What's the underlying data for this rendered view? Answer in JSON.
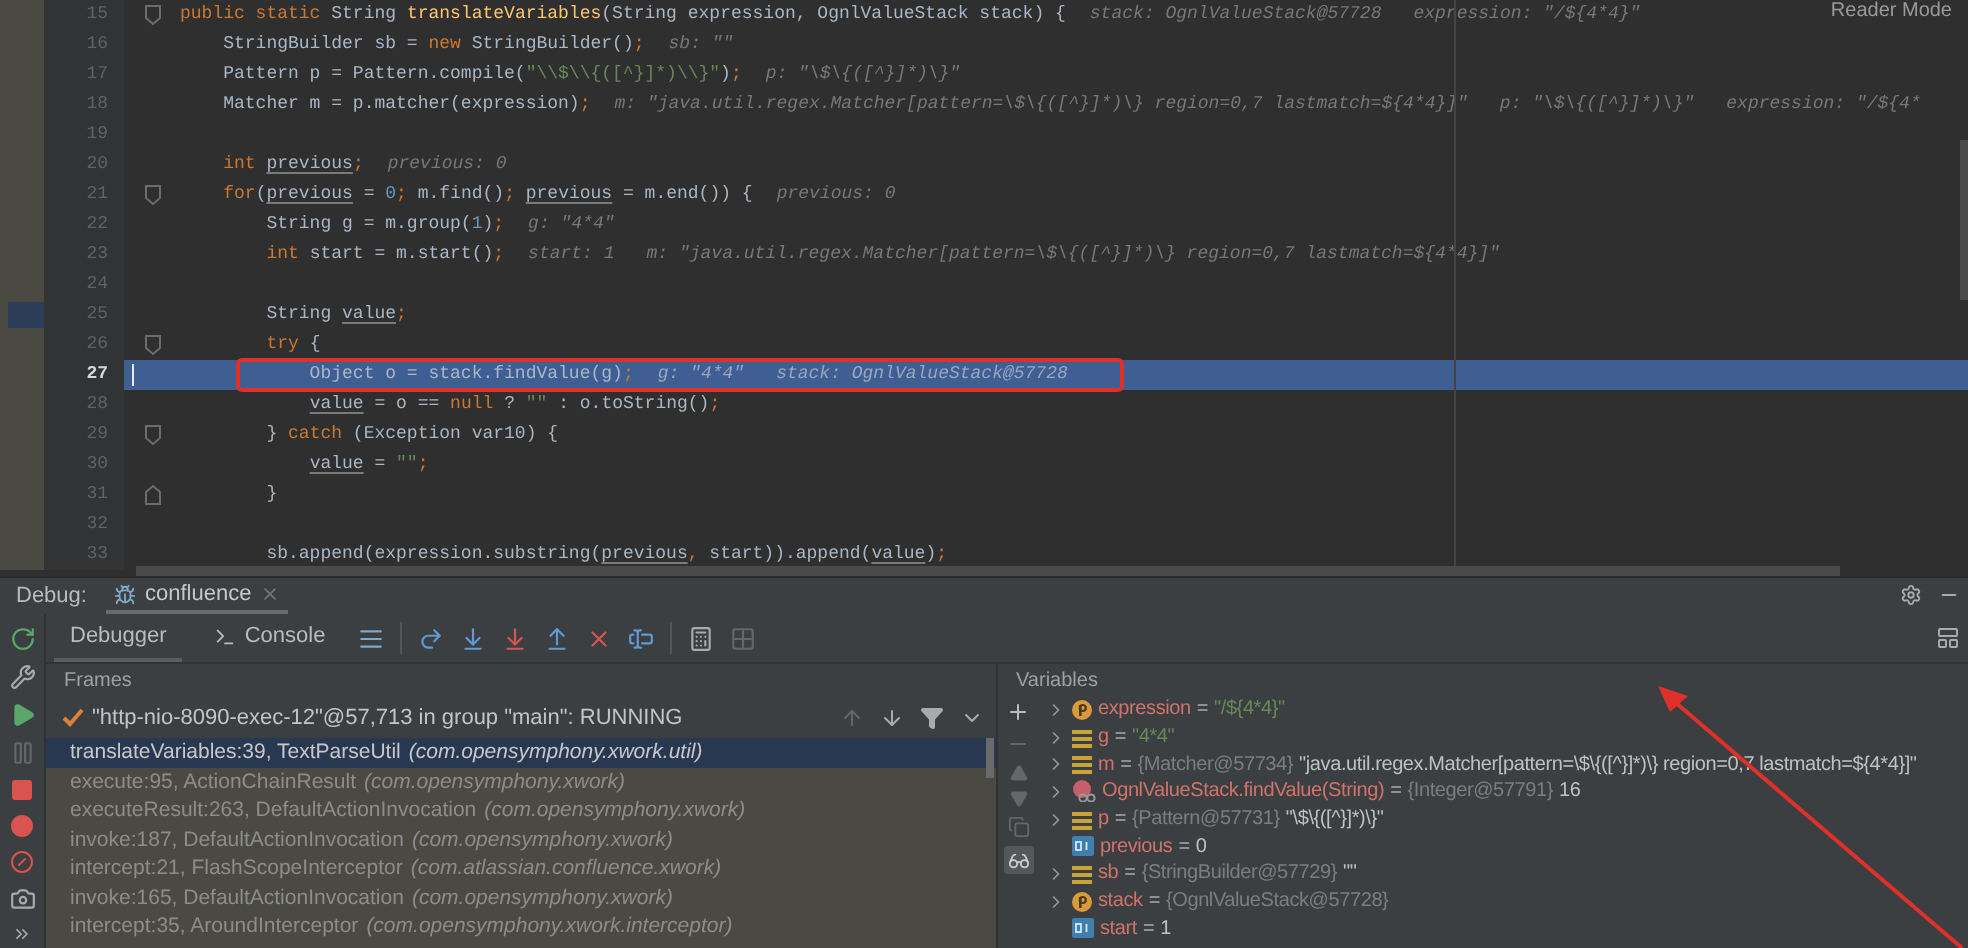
{
  "editor": {
    "reader_mode": "Reader Mode",
    "lines": [
      {
        "number": "15",
        "current": false,
        "bookmarked": false,
        "fold_start": true,
        "fold_end": false,
        "tokens": [
          {
            "kind": "kw",
            "text": "public static "
          },
          {
            "kind": "txt",
            "text": "String "
          },
          {
            "kind": "method",
            "text": "translateVariables"
          },
          {
            "kind": "txt",
            "text": "(String expression, OgnlValueStack stack) {"
          },
          {
            "kind": "hint",
            "text": "stack: OgnlValueStack@57728"
          },
          {
            "kind": "hint",
            "text": "expression: \"/${4*4}\""
          }
        ]
      },
      {
        "number": "16",
        "current": false,
        "bookmarked": false,
        "fold_start": false,
        "fold_end": false,
        "tokens": [
          {
            "kind": "txt",
            "text": "    StringBuilder sb = "
          },
          {
            "kind": "kw",
            "text": "new "
          },
          {
            "kind": "txt",
            "text": "StringBuilder()"
          },
          {
            "kind": "kw",
            "text": ";"
          },
          {
            "kind": "hint",
            "text": "sb: \"\""
          }
        ]
      },
      {
        "number": "17",
        "current": false,
        "bookmarked": false,
        "fold_start": false,
        "fold_end": false,
        "tokens": [
          {
            "kind": "txt",
            "text": "    Pattern p = Pattern.compile("
          },
          {
            "kind": "str",
            "text": "\"\\\\$\\\\{([^}]*)\\\\}\""
          },
          {
            "kind": "txt",
            "text": ")"
          },
          {
            "kind": "kw",
            "text": ";"
          },
          {
            "kind": "hint",
            "text": "p: \"\\$\\{([^}]*)\\}\""
          }
        ]
      },
      {
        "number": "18",
        "current": false,
        "bookmarked": false,
        "fold_start": false,
        "fold_end": false,
        "tokens": [
          {
            "kind": "txt",
            "text": "    Matcher m = p.matcher(expression)"
          },
          {
            "kind": "kw",
            "text": ";"
          },
          {
            "kind": "hint",
            "text": "m: \"java.util.regex.Matcher[pattern=\\$\\{([^}]*)\\} region=0,7 lastmatch=${4*4}]\""
          },
          {
            "kind": "hint",
            "text": "p: \"\\$\\{([^}]*)\\}\""
          },
          {
            "kind": "hint",
            "text": "expression: \"/${4*"
          }
        ]
      },
      {
        "number": "19",
        "current": false,
        "bookmarked": false,
        "fold_start": false,
        "fold_end": false
      },
      {
        "number": "20",
        "current": false,
        "bookmarked": false,
        "fold_start": false,
        "fold_end": false,
        "tokens": [
          {
            "kind": "kw",
            "text": "    int "
          },
          {
            "kind": "var",
            "text": "previous"
          },
          {
            "kind": "kw",
            "text": ";"
          },
          {
            "kind": "hint",
            "text": "previous: 0"
          }
        ]
      },
      {
        "number": "21",
        "current": false,
        "bookmarked": false,
        "fold_start": true,
        "fold_end": false,
        "tokens": [
          {
            "kind": "kw",
            "text": "    for"
          },
          {
            "kind": "txt",
            "text": "("
          },
          {
            "kind": "var",
            "text": "previous"
          },
          {
            "kind": "txt",
            "text": " = "
          },
          {
            "kind": "num",
            "text": "0"
          },
          {
            "kind": "kw",
            "text": ";"
          },
          {
            "kind": "txt",
            "text": " m.find()"
          },
          {
            "kind": "kw",
            "text": ";"
          },
          {
            "kind": "var",
            "text": " previous"
          },
          {
            "kind": "txt",
            "text": " = m.end()) {"
          },
          {
            "kind": "hint",
            "text": "previous: 0"
          }
        ]
      },
      {
        "number": "22",
        "current": false,
        "bookmarked": false,
        "fold_start": false,
        "fold_end": false,
        "tokens": [
          {
            "kind": "txt",
            "text": "        String g = m.group("
          },
          {
            "kind": "num",
            "text": "1"
          },
          {
            "kind": "txt",
            "text": ")"
          },
          {
            "kind": "kw",
            "text": ";"
          },
          {
            "kind": "hint",
            "text": "g: \"4*4\""
          }
        ]
      },
      {
        "number": "23",
        "current": false,
        "bookmarked": false,
        "fold_start": false,
        "fold_end": false,
        "tokens": [
          {
            "kind": "kw",
            "text": "        int "
          },
          {
            "kind": "txt",
            "text": "start = m.start()"
          },
          {
            "kind": "kw",
            "text": ";"
          },
          {
            "kind": "hint",
            "text": "start: 1"
          },
          {
            "kind": "hint",
            "text": "m: \"java.util.regex.Matcher[pattern=\\$\\{([^}]*)\\} region=0,7 lastmatch=${4*4}]\""
          }
        ]
      },
      {
        "number": "24",
        "current": false,
        "bookmarked": false,
        "fold_start": false,
        "fold_end": false
      },
      {
        "number": "25",
        "current": false,
        "bookmarked": true,
        "fold_start": false,
        "fold_end": false,
        "tokens": [
          {
            "kind": "txt",
            "text": "        String "
          },
          {
            "kind": "var",
            "text": "value"
          },
          {
            "kind": "kw",
            "text": ";"
          }
        ]
      },
      {
        "number": "26",
        "current": false,
        "bookmarked": false,
        "fold_start": true,
        "fold_end": false,
        "tokens": [
          {
            "kind": "kw",
            "text": "        try "
          },
          {
            "kind": "txt",
            "text": "{"
          }
        ]
      },
      {
        "number": "27",
        "current": true,
        "bookmarked": false,
        "fold_start": false,
        "fold_end": false,
        "tokens": [
          {
            "kind": "txt",
            "text": "            Object o = stack.findValue(g)"
          },
          {
            "kind": "kw",
            "text": ";"
          },
          {
            "kind": "hint",
            "text": "g: \"4*4\""
          },
          {
            "kind": "hint",
            "text": "stack: OgnlValueStack@57728"
          }
        ]
      },
      {
        "number": "28",
        "current": false,
        "bookmarked": false,
        "fold_start": false,
        "fold_end": false,
        "tokens": [
          {
            "kind": "var",
            "text": "            value"
          },
          {
            "kind": "txt",
            "text": " = o == "
          },
          {
            "kind": "kw",
            "text": "null "
          },
          {
            "kind": "txt",
            "text": "? "
          },
          {
            "kind": "str",
            "text": "\"\""
          },
          {
            "kind": "txt",
            "text": " : o.toString()"
          },
          {
            "kind": "kw",
            "text": ";"
          }
        ]
      },
      {
        "number": "29",
        "current": false,
        "bookmarked": false,
        "fold_start": true,
        "fold_end": false,
        "tokens": [
          {
            "kind": "txt",
            "text": "        } "
          },
          {
            "kind": "kw",
            "text": "catch "
          },
          {
            "kind": "txt",
            "text": "(Exception var10) {"
          }
        ]
      },
      {
        "number": "30",
        "current": false,
        "bookmarked": false,
        "fold_start": false,
        "fold_end": false,
        "tokens": [
          {
            "kind": "var",
            "text": "            value"
          },
          {
            "kind": "txt",
            "text": " = "
          },
          {
            "kind": "str",
            "text": "\"\""
          },
          {
            "kind": "kw",
            "text": ";"
          }
        ]
      },
      {
        "number": "31",
        "current": false,
        "bookmarked": false,
        "fold_start": false,
        "fold_end": true,
        "tokens": [
          {
            "kind": "txt",
            "text": "        }"
          }
        ]
      },
      {
        "number": "32",
        "current": false,
        "bookmarked": false,
        "fold_start": false,
        "fold_end": false
      },
      {
        "number": "33",
        "current": false,
        "bookmarked": false,
        "fold_start": false,
        "fold_end": false,
        "tokens": [
          {
            "kind": "txt",
            "text": "        sb.append(expression.substring("
          },
          {
            "kind": "var",
            "text": "previous"
          },
          {
            "kind": "kw",
            "text": ", "
          },
          {
            "kind": "txt",
            "text": "start)).append("
          },
          {
            "kind": "var",
            "text": "value"
          },
          {
            "kind": "txt",
            "text": ")"
          },
          {
            "kind": "kw",
            "text": ";"
          }
        ]
      }
    ]
  },
  "debug": {
    "label": "Debug:",
    "session_tab": "confluence",
    "tabs": [
      {
        "label": "Debugger",
        "selected": true
      },
      {
        "label": "Console",
        "selected": false
      }
    ],
    "frames": {
      "title": "Frames",
      "thread": "\"http-nio-8090-exec-12\"@57,713 in group \"main\": RUNNING",
      "items": [
        {
          "method": "translateVariables:39, TextParseUtil",
          "package": "(com.opensymphony.xwork.util)",
          "selected": true
        },
        {
          "method": "execute:95, ActionChainResult",
          "package": "(com.opensymphony.xwork)",
          "selected": false
        },
        {
          "method": "executeResult:263, DefaultActionInvocation",
          "package": "(com.opensymphony.xwork)",
          "selected": false
        },
        {
          "method": "invoke:187, DefaultActionInvocation",
          "package": "(com.opensymphony.xwork)",
          "selected": false
        },
        {
          "method": "intercept:21, FlashScopeInterceptor",
          "package": "(com.atlassian.confluence.xwork)",
          "selected": false
        },
        {
          "method": "invoke:165, DefaultActionInvocation",
          "package": "(com.opensymphony.xwork)",
          "selected": false
        },
        {
          "method": "intercept:35, AroundInterceptor",
          "package": "(com.opensymphony.xwork.interceptor)",
          "selected": false
        }
      ]
    },
    "variables": {
      "title": "Variables",
      "items": [
        {
          "kind": "param",
          "expandable": true,
          "name": "expression",
          "equals": "=",
          "string": "\"/${4*4}\""
        },
        {
          "kind": "local",
          "expandable": true,
          "name": "g",
          "equals": "=",
          "string": "\"4*4\""
        },
        {
          "kind": "local",
          "expandable": true,
          "name": "m",
          "equals": "=",
          "ref": "{Matcher@57734}",
          "value": "\"java.util.regex.Matcher[pattern=\\$\\{([^}]*)\\} region=0,7 lastmatch=${4*4}]\""
        },
        {
          "kind": "return",
          "expandable": true,
          "name": "OgnlValueStack.findValue(String)",
          "equals": "=",
          "ref": "{Integer@57791}",
          "value": "16"
        },
        {
          "kind": "local",
          "expandable": true,
          "name": "p",
          "equals": "=",
          "ref": "{Pattern@57731}",
          "value": "\"\\$\\{([^}]*)\\}\""
        },
        {
          "kind": "primitive",
          "expandable": false,
          "name": "previous",
          "equals": "=",
          "value": "0"
        },
        {
          "kind": "local",
          "expandable": true,
          "name": "sb",
          "equals": "=",
          "ref": "{StringBuilder@57729}",
          "value": "\"\""
        },
        {
          "kind": "param",
          "expandable": true,
          "name": "stack",
          "equals": "=",
          "ref": "{OgnlValueStack@57728}"
        },
        {
          "kind": "primitive",
          "expandable": false,
          "name": "start",
          "equals": "=",
          "value": "1"
        }
      ]
    }
  }
}
